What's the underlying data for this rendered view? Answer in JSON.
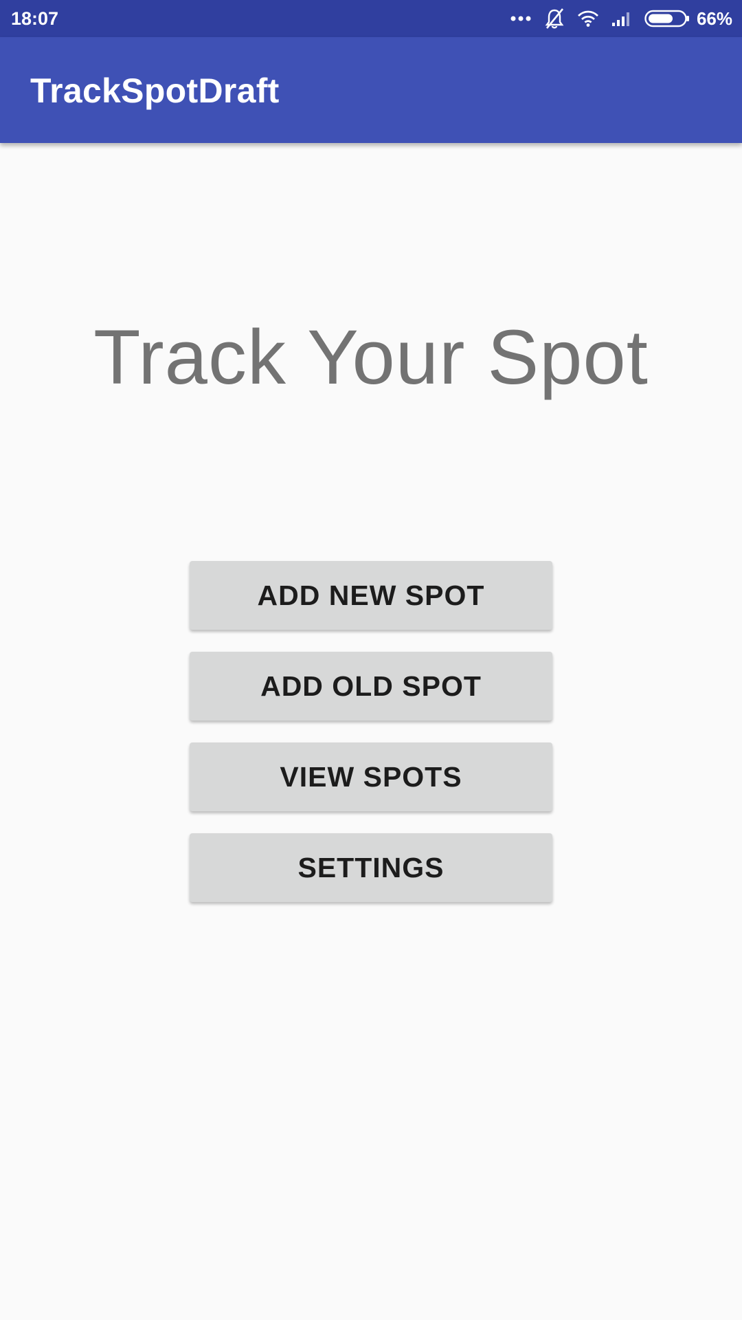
{
  "status_bar": {
    "time": "18:07",
    "battery_percent": "66%",
    "battery_level": 0.66,
    "icons": [
      "more-dots-icon",
      "notifications-off-icon",
      "wifi-icon",
      "signal-icon",
      "battery-icon"
    ]
  },
  "app_bar": {
    "title": "TrackSpotDraft"
  },
  "main": {
    "headline": "Track Your Spot",
    "buttons": [
      {
        "label": "ADD NEW SPOT"
      },
      {
        "label": "ADD OLD SPOT"
      },
      {
        "label": "VIEW SPOTS"
      },
      {
        "label": "SETTINGS"
      }
    ]
  },
  "colors": {
    "status_bar": "#303F9F",
    "app_bar": "#3F51B5",
    "background": "#FAFAFA",
    "button": "#D7D8D8",
    "button_text": "#1C1C1C",
    "headline": "#737373"
  }
}
